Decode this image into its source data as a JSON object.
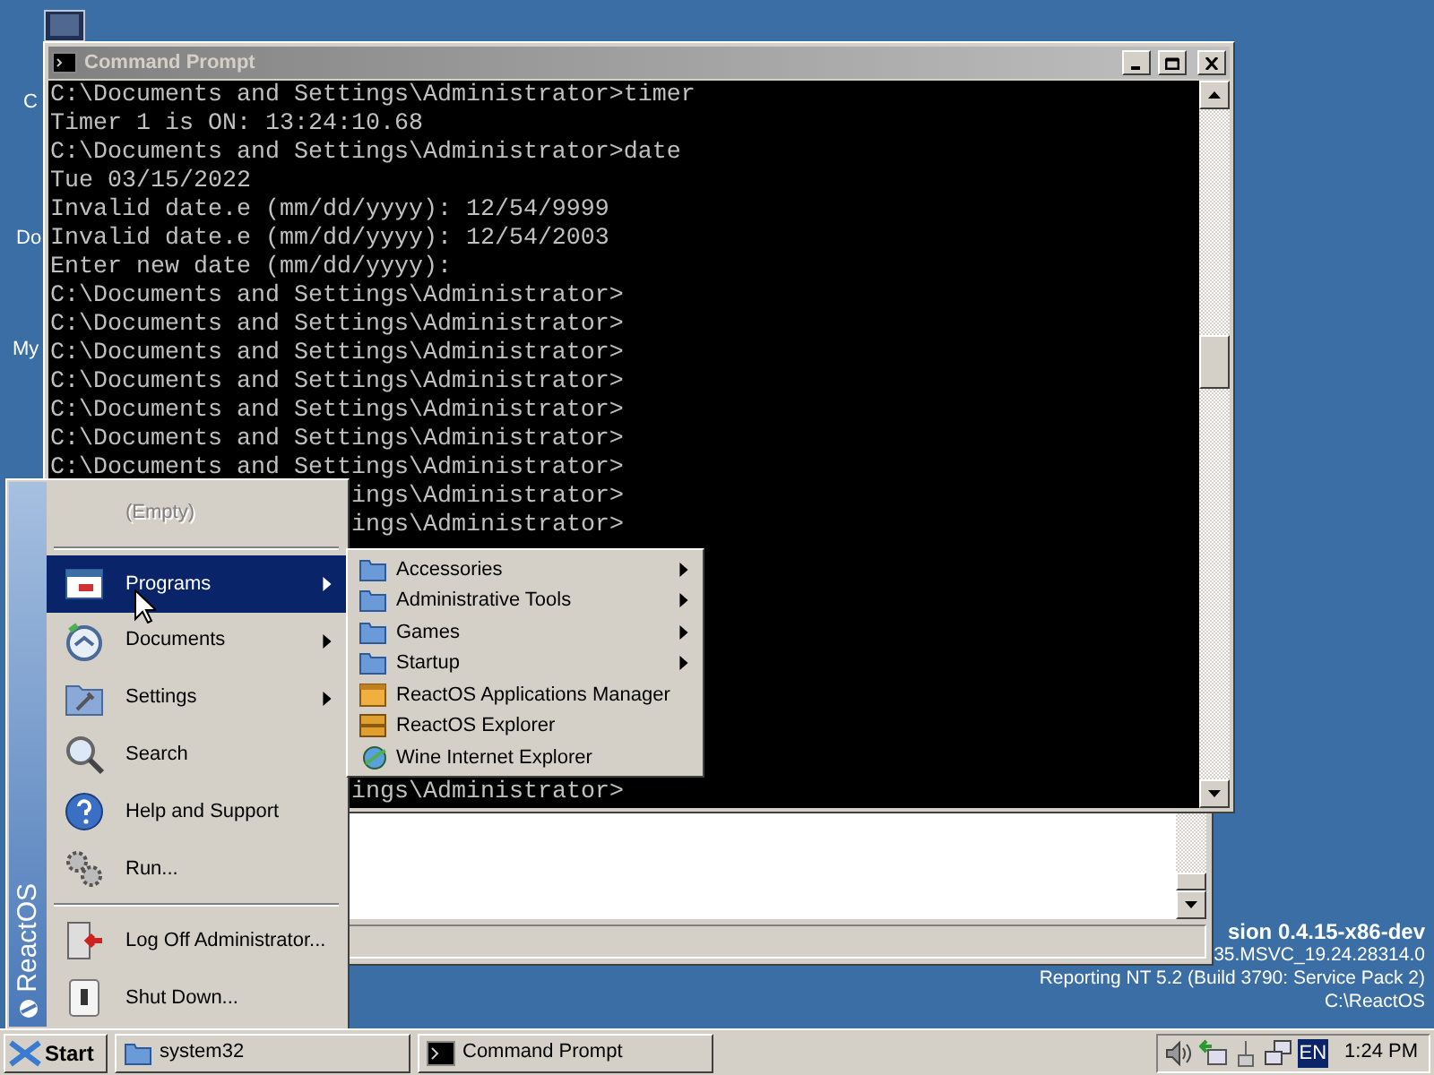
{
  "desktop": {
    "icon_labels": [
      {
        "label": "C"
      },
      {
        "label": "Do"
      },
      {
        "label": "My"
      }
    ],
    "version_info": [
      {
        "text": "sion 0.4.15-x86-dev",
        "bold": true
      },
      {
        "text": "35.MSVC_19.24.28314.0",
        "bold": false
      },
      {
        "text": "Reporting NT 5.2 (Build 3790: Service Pack 2)",
        "bold": false
      },
      {
        "text": "C:\\ReactOS",
        "bold": false
      }
    ]
  },
  "console_window": {
    "title": "Command Prompt",
    "active": false,
    "lines": [
      "C:\\Documents and Settings\\Administrator>timer",
      "Timer 1 is ON: 13:24:10.68",
      "C:\\Documents and Settings\\Administrator>date",
      "Tue 03/15/2022",
      "Invalid date.e (mm/dd/yyyy): 12/54/9999",
      "Invalid date.e (mm/dd/yyyy): 12/54/2003",
      "Enter new date (mm/dd/yyyy):",
      "C:\\Documents and Settings\\Administrator>",
      "C:\\Documents and Settings\\Administrator>",
      "C:\\Documents and Settings\\Administrator>",
      "C:\\Documents and Settings\\Administrator>",
      "C:\\Documents and Settings\\Administrator>",
      "C:\\Documents and Settings\\Administrator>",
      "C:\\Documents and Settings\\Administrator>"
    ],
    "tail_lines": [
      "ings\\Administrator>",
      "ings\\Administrator>"
    ],
    "bottom_tail_lines": [
      "ings\\Administrator>"
    ]
  },
  "start_menu": {
    "banner": "ReactOS",
    "sections": [
      [
        {
          "label": "(Empty)",
          "kind": "none",
          "disabled": true,
          "selected": false,
          "submenu": false
        }
      ],
      [
        {
          "label": "Programs",
          "kind": "programs",
          "disabled": false,
          "selected": true,
          "submenu": true
        },
        {
          "label": "Documents",
          "kind": "documents",
          "disabled": false,
          "selected": false,
          "submenu": true
        },
        {
          "label": "Settings",
          "kind": "settings",
          "disabled": false,
          "selected": false,
          "submenu": true
        },
        {
          "label": "Search",
          "kind": "search",
          "disabled": false,
          "selected": false,
          "submenu": false
        },
        {
          "label": "Help and Support",
          "kind": "help",
          "disabled": false,
          "selected": false,
          "submenu": false
        },
        {
          "label": "Run...",
          "kind": "run",
          "disabled": false,
          "selected": false,
          "submenu": false
        }
      ],
      [
        {
          "label": "Log Off Administrator...",
          "kind": "logoff",
          "disabled": false,
          "selected": false,
          "submenu": false
        },
        {
          "label": "Shut Down...",
          "kind": "shutdown",
          "disabled": false,
          "selected": false,
          "submenu": false
        }
      ]
    ]
  },
  "programs_submenu": {
    "items": [
      {
        "label": "Accessories",
        "kind": "folder",
        "submenu": true
      },
      {
        "label": "Administrative Tools",
        "kind": "folder",
        "submenu": true
      },
      {
        "label": "Games",
        "kind": "folder",
        "submenu": true
      },
      {
        "label": "Startup",
        "kind": "folder",
        "submenu": true
      },
      {
        "label": "ReactOS Applications Manager",
        "kind": "appmanager",
        "submenu": false
      },
      {
        "label": "ReactOS Explorer",
        "kind": "explorer",
        "submenu": false
      },
      {
        "label": "Wine Internet Explorer",
        "kind": "browser",
        "submenu": false
      }
    ]
  },
  "taskbar": {
    "start": "Start",
    "tasks": [
      {
        "label": "system32",
        "kind": "folder",
        "selected": false
      },
      {
        "label": "Command Prompt",
        "kind": "console",
        "selected": false
      }
    ],
    "language": "EN",
    "clock": "1:24 PM"
  }
}
